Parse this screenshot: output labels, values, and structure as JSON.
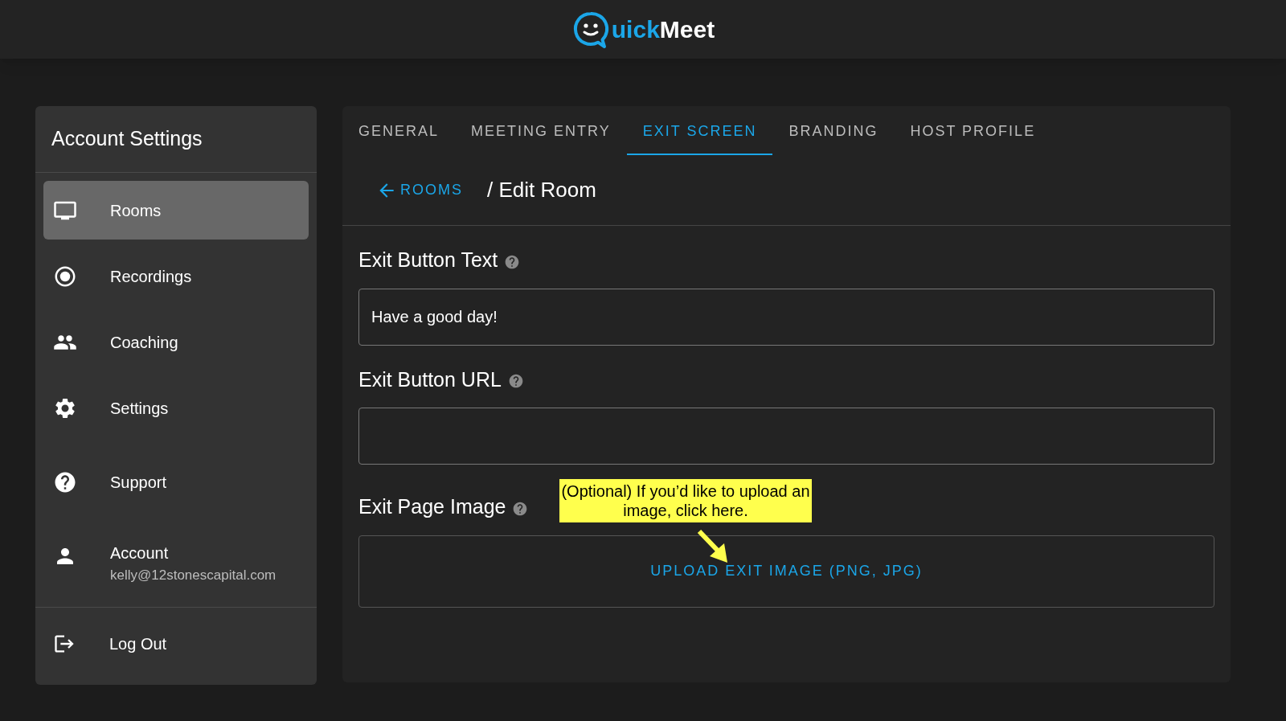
{
  "logo": {
    "accent": "uick",
    "rest": "Meet"
  },
  "sidebar": {
    "title": "Account Settings",
    "items": [
      {
        "label": "Rooms",
        "selected": true
      },
      {
        "label": "Recordings",
        "selected": false
      },
      {
        "label": "Coaching",
        "selected": false
      },
      {
        "label": "Settings",
        "selected": false
      },
      {
        "label": "Support",
        "selected": false
      },
      {
        "label": "Account",
        "subtitle": "kelly@12stonescapital.com",
        "selected": false
      }
    ],
    "logout": "Log Out"
  },
  "tabs": [
    {
      "label": "GENERAL",
      "selected": false
    },
    {
      "label": "MEETING ENTRY",
      "selected": false
    },
    {
      "label": "EXIT SCREEN",
      "selected": true
    },
    {
      "label": "BRANDING",
      "selected": false
    },
    {
      "label": "HOST PROFILE",
      "selected": false
    }
  ],
  "breadcrumb": {
    "back": "ROOMS",
    "current": "/ Edit Room"
  },
  "fields": [
    {
      "kind": "text",
      "label": "Exit Button Text",
      "value": "Have a good day!"
    },
    {
      "kind": "text",
      "label": "Exit Button URL"
    },
    {
      "kind": "upload",
      "label": "Exit Page Image",
      "button": "UPLOAD EXIT IMAGE (PNG, JPG)"
    }
  ],
  "callout": "(Optional) If you’d like to upload an image, click here."
}
